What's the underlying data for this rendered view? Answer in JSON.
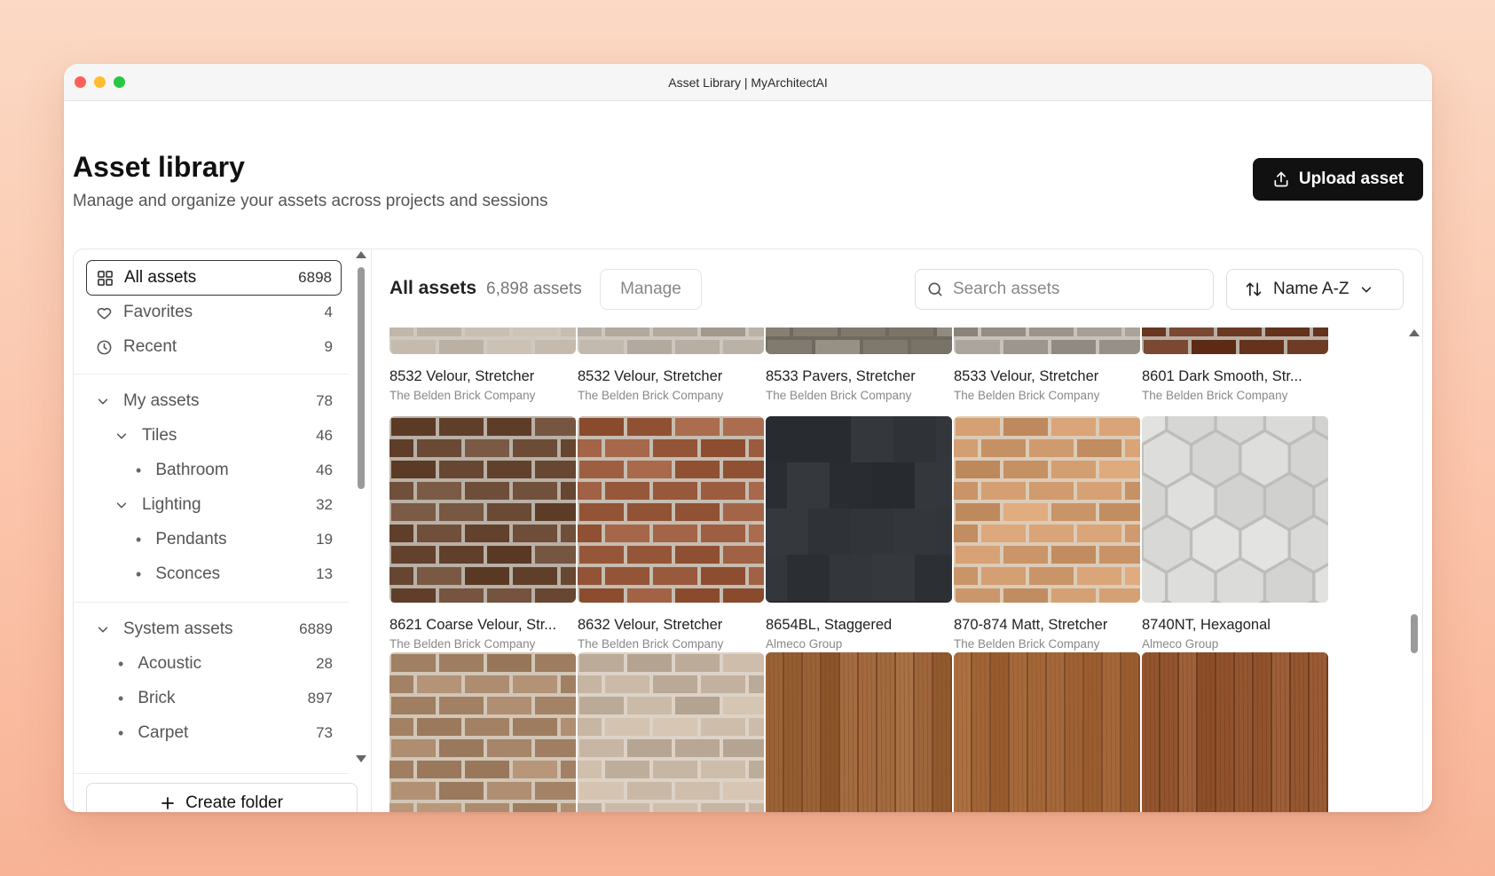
{
  "window": {
    "title": "Asset Library | MyArchitectAI"
  },
  "header": {
    "title": "Asset library",
    "subtitle": "Manage and organize your assets across projects and sessions",
    "upload_label": "Upload asset"
  },
  "sidebar": {
    "items": [
      {
        "label": "All assets",
        "count": "6898",
        "icon": "grid-icon"
      },
      {
        "label": "Favorites",
        "count": "4",
        "icon": "heart-icon"
      },
      {
        "label": "Recent",
        "count": "9",
        "icon": "clock-icon"
      }
    ],
    "my_assets": {
      "label": "My assets",
      "count": "78",
      "tiles": {
        "label": "Tiles",
        "count": "46",
        "children": [
          {
            "label": "Bathroom",
            "count": "46"
          }
        ]
      },
      "lighting": {
        "label": "Lighting",
        "count": "32",
        "children": [
          {
            "label": "Pendants",
            "count": "19"
          },
          {
            "label": "Sconces",
            "count": "13"
          }
        ]
      }
    },
    "system_assets": {
      "label": "System assets",
      "count": "6889",
      "children": [
        {
          "label": "Acoustic",
          "count": "28"
        },
        {
          "label": "Brick",
          "count": "897"
        },
        {
          "label": "Carpet",
          "count": "73"
        }
      ]
    },
    "create_folder_label": "Create folder"
  },
  "main": {
    "title": "All assets",
    "count_label": "6,898 assets",
    "manage_label": "Manage",
    "search_placeholder": "Search assets",
    "sort_label": "Name A-Z"
  },
  "assets": [
    {
      "name": "8532 Velour, Stretcher",
      "maker": "The Belden Brick Company",
      "texture": "brick",
      "color": "#bcb3a6",
      "mortar": "#cfc9c0"
    },
    {
      "name": "8532 Velour, Stretcher",
      "maker": "The Belden Brick Company",
      "texture": "brick",
      "color": "#b3aaa0",
      "mortar": "#cdc7bf"
    },
    {
      "name": "8533 Pavers, Stretcher",
      "maker": "The Belden Brick Company",
      "texture": "brick",
      "color": "#8a8478",
      "mortar": "#6f6a60"
    },
    {
      "name": "8533 Velour, Stretcher",
      "maker": "The Belden Brick Company",
      "texture": "brick",
      "color": "#9a948c",
      "mortar": "#c7c2ba"
    },
    {
      "name": "8601 Dark Smooth, Str...",
      "maker": "The Belden Brick Company",
      "texture": "brick",
      "color": "#6e3b25",
      "mortar": "#b9aea2"
    },
    {
      "name": "8621 Coarse Velour, Str...",
      "maker": "The Belden Brick Company",
      "texture": "brick",
      "color": "#6b4a36",
      "mortar": "#b9b0a5"
    },
    {
      "name": "8632 Velour, Stretcher",
      "maker": "The Belden Brick Company",
      "texture": "brick",
      "color": "#9a5b3e",
      "mortar": "#c6bcb0"
    },
    {
      "name": "8654BL, Staggered",
      "maker": "Almeco Group",
      "texture": "tile",
      "color": "#2e3136",
      "mortar": "#26292d"
    },
    {
      "name": "870-874 Matt, Stretcher",
      "maker": "The Belden Brick Company",
      "texture": "brick",
      "color": "#cf9a6e",
      "mortar": "#dccbb6"
    },
    {
      "name": "8740NT, Hexagonal",
      "maker": "Almeco Group",
      "texture": "hex",
      "color": "#d6d6d4",
      "mortar": "#bdbdbb"
    },
    {
      "name": "",
      "maker": "",
      "texture": "brick",
      "color": "#a8876b",
      "mortar": "#d2c6b6"
    },
    {
      "name": "",
      "maker": "",
      "texture": "brick",
      "color": "#c6b5a2",
      "mortar": "#ddd2c5"
    },
    {
      "name": "",
      "maker": "",
      "texture": "wood",
      "color": "#9b6338",
      "mortar": "#7a4a26"
    },
    {
      "name": "",
      "maker": "",
      "texture": "wood",
      "color": "#a5693b",
      "mortar": "#804d28"
    },
    {
      "name": "",
      "maker": "",
      "texture": "wood",
      "color": "#93552f",
      "mortar": "#6e3d1f"
    }
  ]
}
